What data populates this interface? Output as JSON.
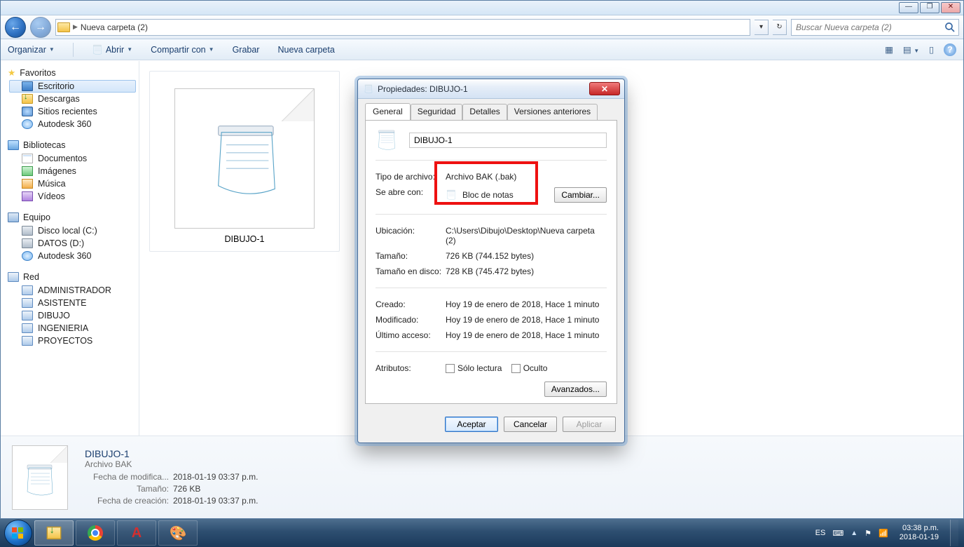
{
  "window": {
    "min_icon": "—",
    "max_icon": "❐",
    "close_icon": "✕"
  },
  "address": {
    "folder": "Nueva carpeta (2)",
    "refresh": "↻"
  },
  "search": {
    "placeholder": "Buscar Nueva carpeta (2)"
  },
  "toolbar": {
    "organize": "Organizar",
    "open": "Abrir",
    "share": "Compartir con",
    "burn": "Grabar",
    "newfolder": "Nueva carpeta"
  },
  "sidebar": {
    "favorites": "Favoritos",
    "items_fav": [
      "Escritorio",
      "Descargas",
      "Sitios recientes",
      "Autodesk 360"
    ],
    "libraries": "Bibliotecas",
    "items_lib": [
      "Documentos",
      "Imágenes",
      "Música",
      "Vídeos"
    ],
    "computer": "Equipo",
    "items_comp": [
      "Disco local (C:)",
      "DATOS (D:)",
      "Autodesk 360"
    ],
    "network": "Red",
    "items_net": [
      "ADMINISTRADOR",
      "ASISTENTE",
      "DIBUJO",
      "INGENIERIA",
      "PROYECTOS"
    ]
  },
  "file": {
    "name": "DIBUJO-1"
  },
  "details": {
    "name": "DIBUJO-1",
    "type": "Archivo BAK",
    "mod_label": "Fecha de modifica...",
    "mod_value": "2018-01-19 03:37 p.m.",
    "size_label": "Tamaño:",
    "size_value": "726 KB",
    "created_label": "Fecha de creación:",
    "created_value": "2018-01-19 03:37 p.m."
  },
  "dialog": {
    "title": "Propiedades: DIBUJO-1",
    "tabs": [
      "General",
      "Seguridad",
      "Detalles",
      "Versiones anteriores"
    ],
    "filename": "DIBUJO-1",
    "rows": {
      "type_label": "Tipo de archivo:",
      "type_value": "Archivo BAK (.bak)",
      "opens_label": "Se abre con:",
      "opens_value": "Bloc de notas",
      "change_btn": "Cambiar...",
      "location_label": "Ubicación:",
      "location_value": "C:\\Users\\Dibujo\\Desktop\\Nueva carpeta (2)",
      "size_label": "Tamaño:",
      "size_value": "726 KB (744.152 bytes)",
      "sizeondisk_label": "Tamaño en disco:",
      "sizeondisk_value": "728 KB (745.472 bytes)",
      "created_label": "Creado:",
      "created_value": "Hoy 19 de enero de 2018, Hace 1 minuto",
      "modified_label": "Modificado:",
      "modified_value": "Hoy 19 de enero de 2018, Hace 1 minuto",
      "accessed_label": "Último acceso:",
      "accessed_value": "Hoy 19 de enero de 2018, Hace 1 minuto",
      "attributes_label": "Atributos:",
      "readonly": "Sólo lectura",
      "hidden": "Oculto",
      "advanced_btn": "Avanzados..."
    },
    "buttons": {
      "ok": "Aceptar",
      "cancel": "Cancelar",
      "apply": "Aplicar"
    }
  },
  "taskbar": {
    "lang": "ES",
    "time": "03:38 p.m.",
    "date": "2018-01-19"
  }
}
